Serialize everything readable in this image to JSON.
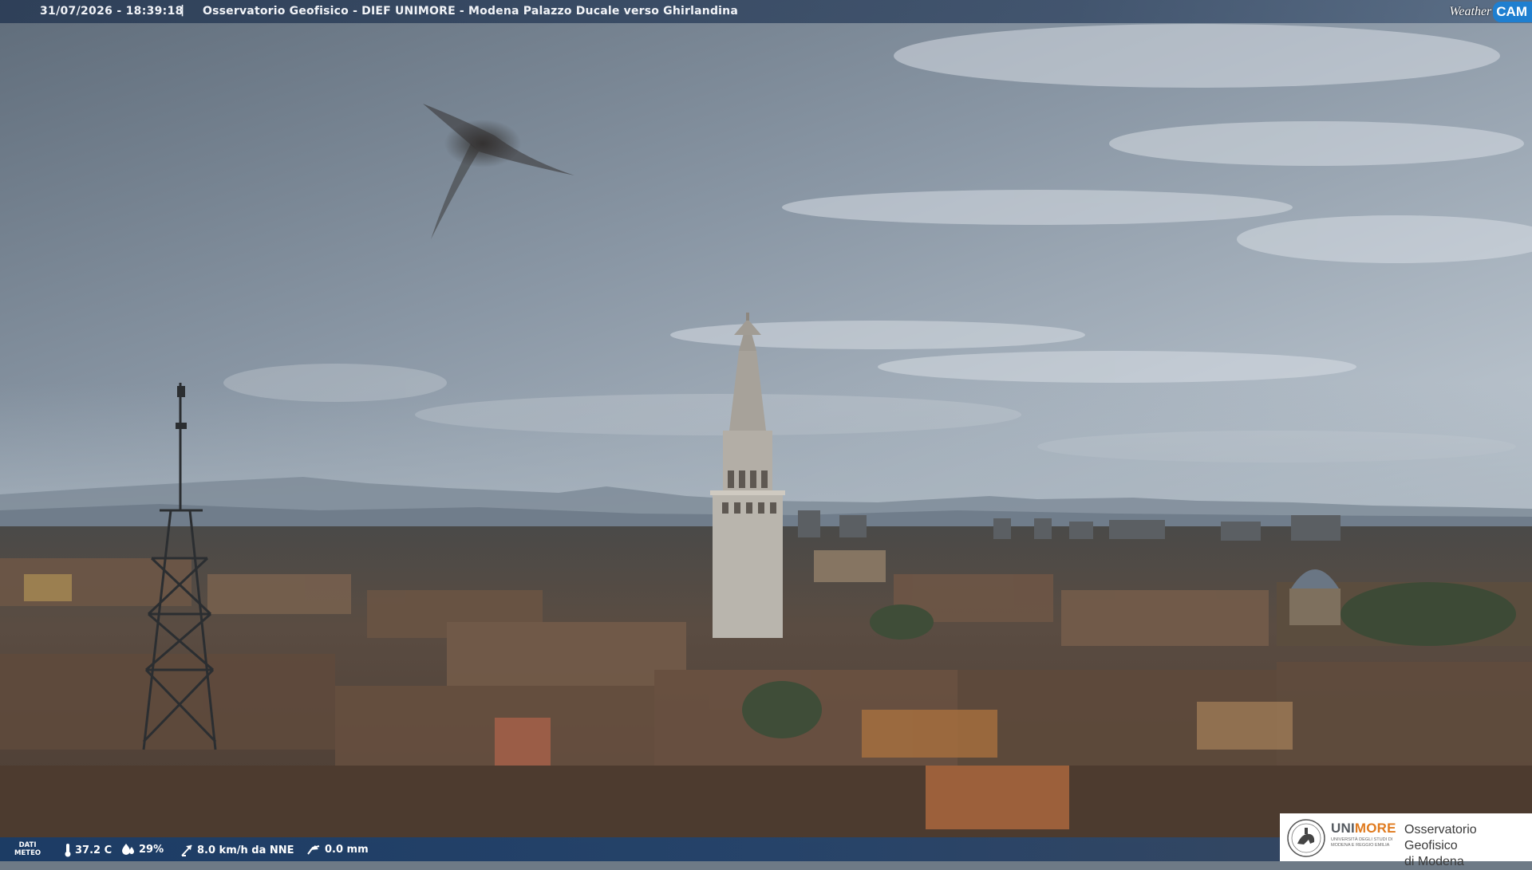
{
  "top_bar": {
    "datetime": "31/07/2026 - 18:39:18",
    "separator": "|",
    "title": "Osservatorio Geofisico - DIEF UNIMORE - Modena Palazzo Ducale verso Ghirlandina"
  },
  "brand": {
    "part1": "Weather",
    "part2": "CAM",
    "accent_color": "#1f7fd0"
  },
  "bottom_bar": {
    "dati_label_1": "DATI",
    "dati_label_2": "METEO",
    "temperature": "37.2 C",
    "humidity": "29%",
    "wind": "8.0 km/h da NNE",
    "rain": "0.0 mm"
  },
  "logo": {
    "brand_uni": "UNI",
    "brand_more": "MORE",
    "university_line_1": "UNIVERSITÀ DEGLI STUDI DI",
    "university_line_2": "MODENA E REGGIO EMILIA",
    "observatory_line_1": "Osservatorio Geofisico",
    "observatory_line_2": "di Modena",
    "accent_color": "#e07b1f"
  },
  "icons": {
    "temperature": "thermometer-icon",
    "humidity": "droplet-icon",
    "wind": "wind-vane-icon",
    "rain": "rain-gauge-icon"
  }
}
